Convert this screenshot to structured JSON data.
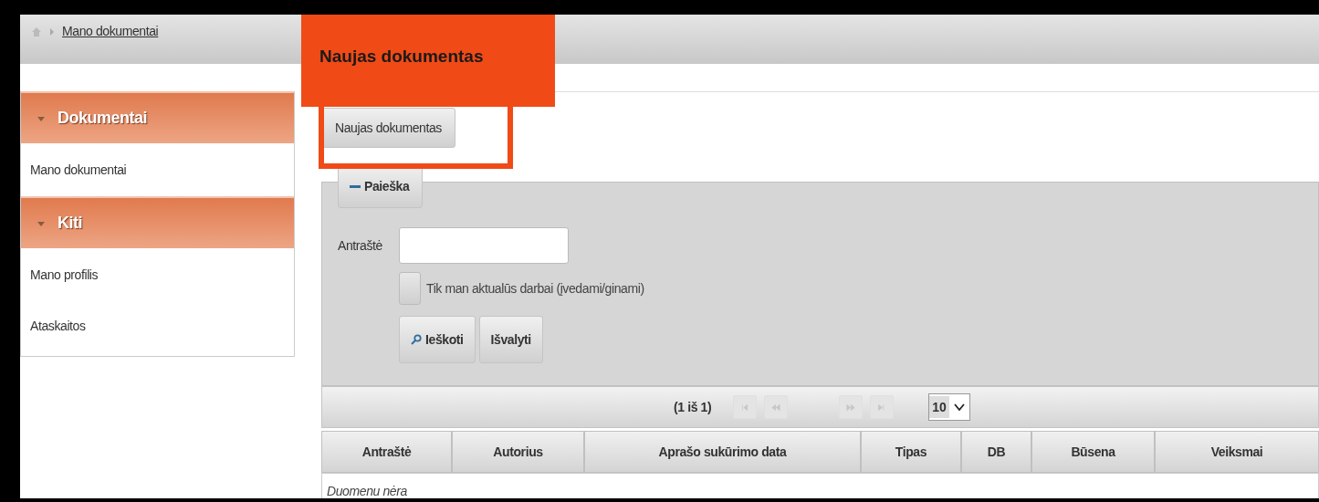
{
  "breadcrumb": {
    "items": [
      {
        "label": "Mano dokumentai"
      }
    ]
  },
  "callout": {
    "text": "Naujas dokumentas"
  },
  "sidebar": {
    "sections": [
      {
        "title": "Dokumentai",
        "expanded": true,
        "items": [
          {
            "label": "Mano dokumentai"
          }
        ]
      },
      {
        "title": "Kiti",
        "expanded": true,
        "items": [
          {
            "label": "Mano profilis"
          },
          {
            "label": "Ataskaitos"
          }
        ]
      }
    ]
  },
  "toolbar": {
    "button": "Naujas dokumentas"
  },
  "search": {
    "legend": "Paieška",
    "expanded": true,
    "field_label": "Antraštė",
    "checkbox": {
      "label": "Tik man aktualūs darbai (įvedami/ginami)",
      "checked": false
    },
    "buttons": [
      {
        "label": "Ieškoti",
        "kind": "search"
      },
      {
        "label": "Išvalyti",
        "kind": "clear"
      }
    ]
  },
  "paginator": {
    "status": "(1 iš 1)",
    "buttons": [
      {
        "kind": "first",
        "disabled": true
      },
      {
        "kind": "prev",
        "disabled": true
      },
      {
        "kind": "next",
        "disabled": true
      },
      {
        "kind": "last",
        "disabled": true
      }
    ],
    "page_size": "10"
  },
  "table": {
    "columns": [
      "Antraštė",
      "Autorius",
      "Aprašo sukūrimo data",
      "Tipas",
      "DB",
      "Būsena",
      "Veiksmai"
    ],
    "empty_message": "Duomenu nėra"
  }
}
